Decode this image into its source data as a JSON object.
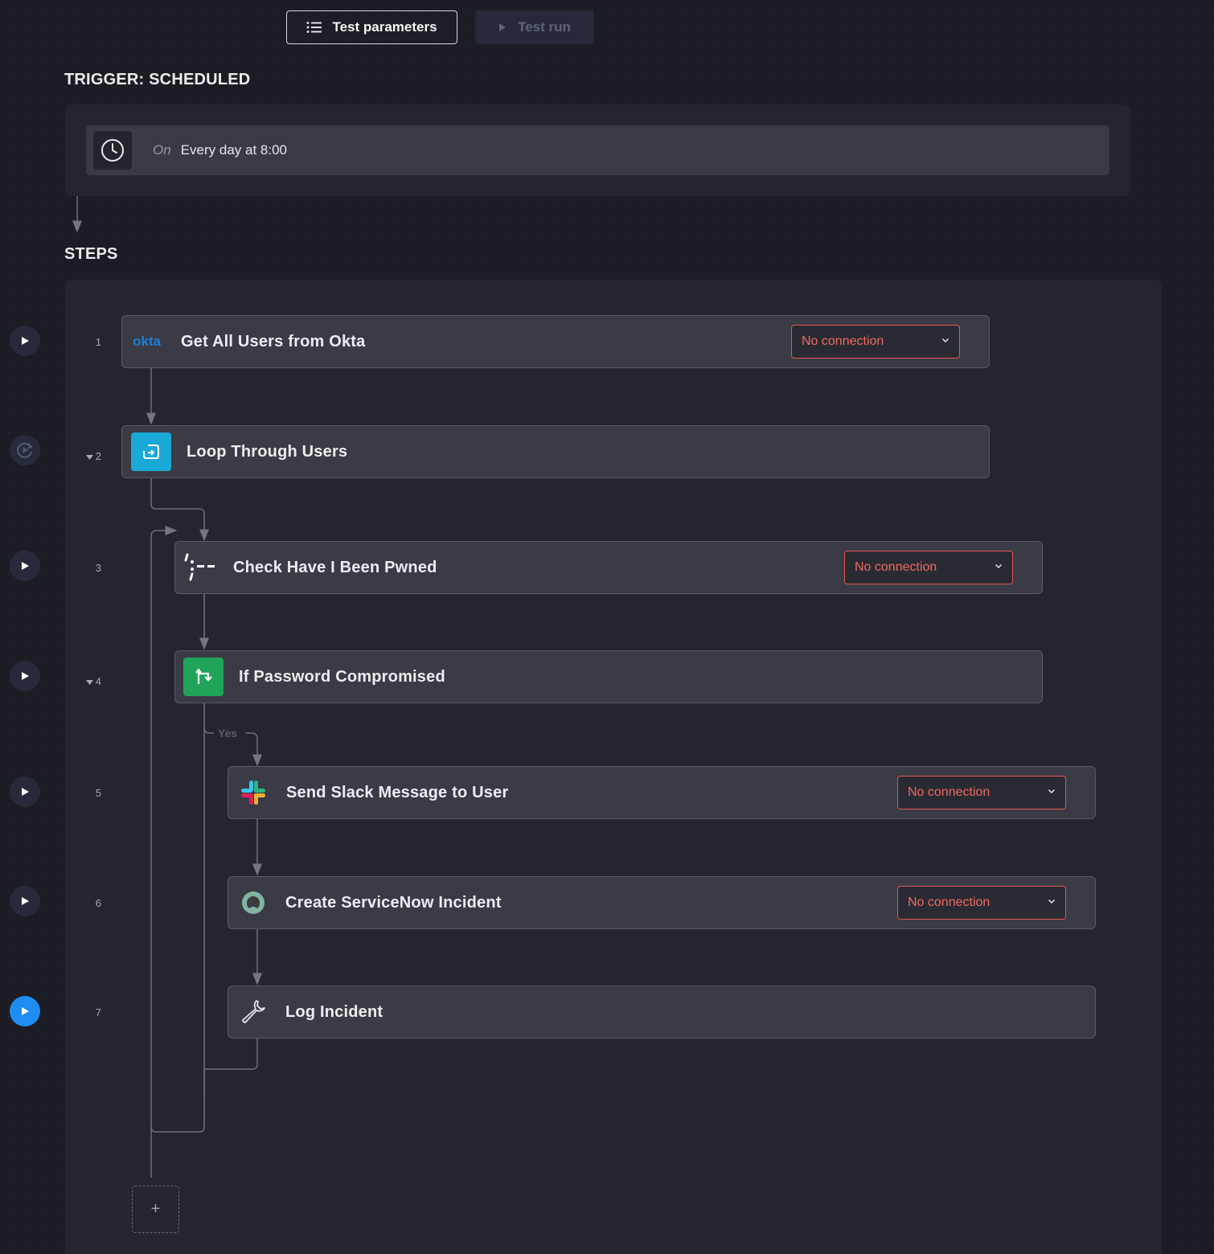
{
  "toolbar": {
    "test_parameters_label": "Test parameters",
    "test_run_label": "Test run"
  },
  "trigger": {
    "section_title": "TRIGGER: SCHEDULED",
    "on_label": "On",
    "schedule_text": "Every day at 8:00"
  },
  "steps_section": {
    "section_title": "STEPS",
    "add_step_label": "+",
    "branch_label": "Yes"
  },
  "connection_placeholder": "No connection",
  "steps": [
    {
      "number": "1",
      "title": "Get All Users from Okta",
      "icon": "okta-logo-icon",
      "logo_text": "okta",
      "has_connection_select": true,
      "collapsible": false
    },
    {
      "number": "2",
      "title": "Loop Through Users",
      "icon": "loop-icon",
      "has_connection_select": false,
      "collapsible": true
    },
    {
      "number": "3",
      "title": "Check Have I Been Pwned",
      "icon": "hibp-logo-icon",
      "has_connection_select": true,
      "collapsible": false
    },
    {
      "number": "4",
      "title": "If Password Compromised",
      "icon": "branch-icon",
      "has_connection_select": false,
      "collapsible": true
    },
    {
      "number": "5",
      "title": "Send Slack Message to User",
      "icon": "slack-logo-icon",
      "has_connection_select": true,
      "collapsible": false
    },
    {
      "number": "6",
      "title": "Create ServiceNow Incident",
      "icon": "servicenow-logo-icon",
      "has_connection_select": true,
      "collapsible": false
    },
    {
      "number": "7",
      "title": "Log Incident",
      "icon": "wrench-icon",
      "has_connection_select": false,
      "collapsible": false
    }
  ],
  "colors": {
    "background": "#1c1c24",
    "panel": "#25252e",
    "card": "#3b3b45",
    "error_red": "#ee6a60",
    "active_blue": "#1e8cf0",
    "loop_cyan": "#1aa8d6",
    "branch_green": "#1fa45a",
    "okta_blue": "#1a7fd4"
  }
}
